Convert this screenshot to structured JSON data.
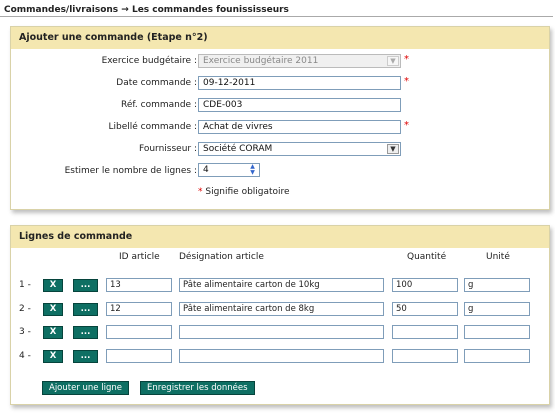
{
  "breadcrumb": "Commandes/livraisons → Les commandes founississeurs",
  "form": {
    "title": "Ajouter une commande (Etape n°2)",
    "fields": {
      "exercice": {
        "label": "Exercice budgétaire :",
        "value": "Exercice budgétaire 2011"
      },
      "date": {
        "label": "Date commande :",
        "value": "09-12-2011"
      },
      "ref": {
        "label": "Réf. commande :",
        "value": "CDE-003"
      },
      "libelle": {
        "label": "Libellé commande :",
        "value": "Achat de vivres"
      },
      "fournisseur": {
        "label": "Fournisseur :",
        "value": "Société CORAM"
      },
      "nb_lignes": {
        "label": "Estimer le nombre de lignes :",
        "value": "4"
      }
    },
    "required_mark": "*",
    "required_note": "Signifie obligatoire"
  },
  "lines": {
    "title": "Lignes de commande",
    "columns": [
      "ID article",
      "Désignation article",
      "Quantité",
      "Unité"
    ],
    "delete_label": "X",
    "more_label": "...",
    "rows": [
      {
        "num": "1 -",
        "id": "13",
        "designation": "Pâte alimentaire carton de 10kg",
        "qty": "100",
        "unit": "g"
      },
      {
        "num": "2 -",
        "id": "12",
        "designation": "Pâte alimentaire carton de 8kg",
        "qty": "50",
        "unit": "g"
      },
      {
        "num": "3 -",
        "id": "",
        "designation": "",
        "qty": "",
        "unit": ""
      },
      {
        "num": "4 -",
        "id": "",
        "designation": "",
        "qty": "",
        "unit": ""
      }
    ],
    "add_button": "Ajouter une ligne",
    "save_button": "Enregistrer les données"
  }
}
